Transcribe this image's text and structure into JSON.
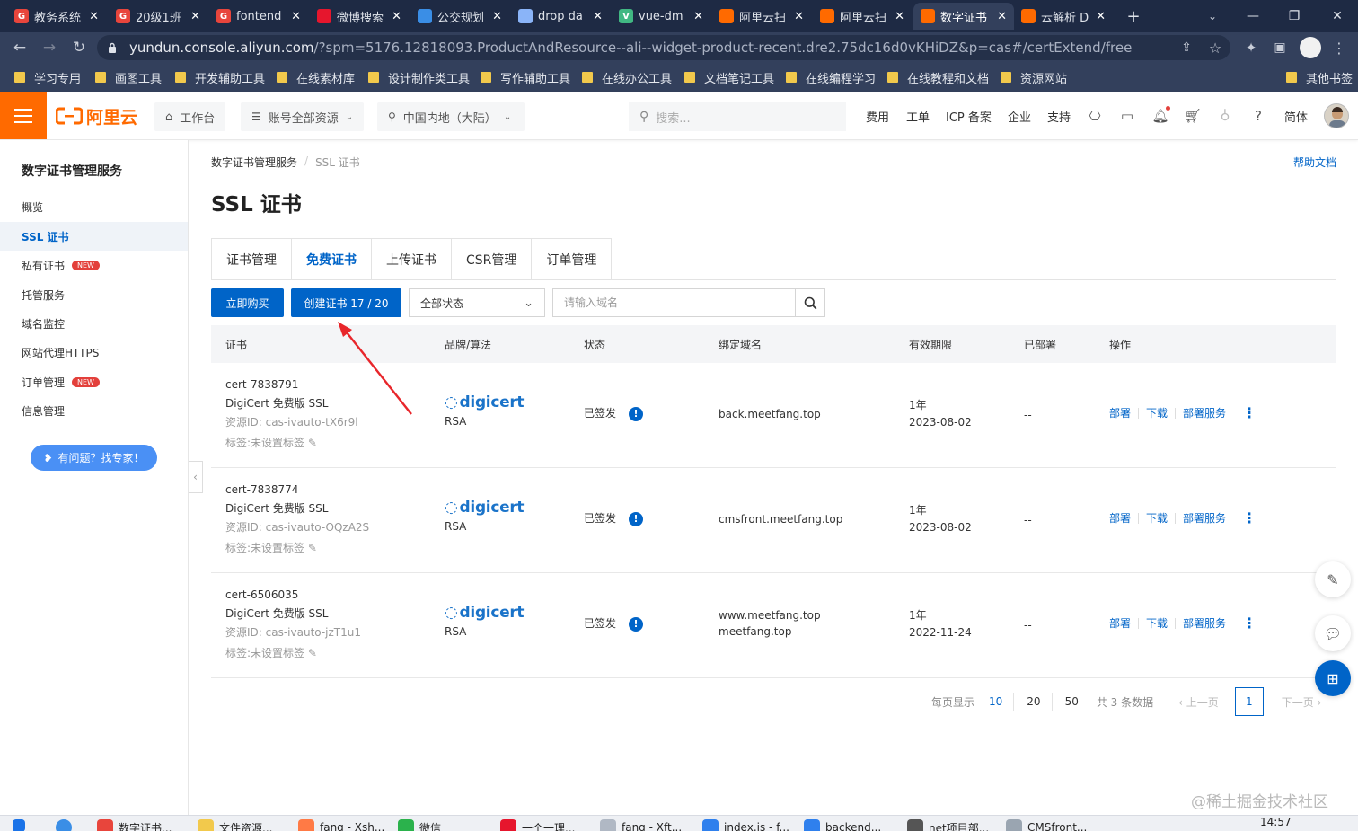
{
  "browser": {
    "tabs": [
      {
        "label": "教务系统",
        "icon": "G",
        "icon_color": "#e8453c"
      },
      {
        "label": "20级1班",
        "icon": "G",
        "icon_color": "#e8453c"
      },
      {
        "label": "fontend",
        "icon": "G",
        "icon_color": "#e8453c"
      },
      {
        "label": "微博搜索",
        "icon": "weibo",
        "icon_color": "#e6162d"
      },
      {
        "label": "公交规划",
        "icon": "map",
        "icon_color": "#3a8ee6"
      },
      {
        "label": "drop da",
        "icon": "search",
        "icon_color": "#8ab4f8"
      },
      {
        "label": "vue-dm",
        "icon": "V",
        "icon_color": "#41b883"
      },
      {
        "label": "阿里云扫",
        "icon": "aliyun",
        "icon_color": "#ff6a00"
      },
      {
        "label": "阿里云扫",
        "icon": "aliyun",
        "icon_color": "#ff6a00"
      },
      {
        "label": "数字证书",
        "icon": "aliyun",
        "icon_color": "#ff6a00"
      },
      {
        "label": "云解析 D",
        "icon": "aliyun",
        "icon_color": "#ff6a00"
      }
    ],
    "url_main": "yundun.console.aliyun.com",
    "url_rest": "/?spm=5176.12818093.ProductAndResource--ali--widget-product-recent.dre2.75dc16d0vKHiDZ&p=cas#/certExtend/free",
    "bookmarks": [
      "学习专用",
      "画图工具",
      "开发辅助工具",
      "在线素材库",
      "设计制作类工具",
      "写作辅助工具",
      "在线办公工具",
      "文档笔记工具",
      "在线编程学习",
      "在线教程和文档",
      "资源网站",
      "其他书签"
    ]
  },
  "topnav": {
    "logo": "阿里云",
    "workbench": "工作台",
    "account_resources": "账号全部资源",
    "region": "中国内地（大陆）",
    "search_placeholder": "搜索...",
    "links": [
      "费用",
      "工单",
      "ICP 备案",
      "企业",
      "支持"
    ],
    "lang": "简体"
  },
  "sidebar": {
    "title": "数字证书管理服务",
    "items": [
      {
        "label": "概览",
        "badge": ""
      },
      {
        "label": "SSL 证书",
        "badge": ""
      },
      {
        "label": "私有证书",
        "badge": "NEW"
      },
      {
        "label": "托管服务",
        "badge": ""
      },
      {
        "label": "域名监控",
        "badge": ""
      },
      {
        "label": "网站代理HTTPS",
        "badge": ""
      },
      {
        "label": "订单管理",
        "badge": "NEW"
      },
      {
        "label": "信息管理",
        "badge": ""
      }
    ],
    "help_button": "有问题？找专家！"
  },
  "main": {
    "breadcrumb": [
      "数字证书管理服务",
      "SSL 证书"
    ],
    "help_doc": "帮助文档",
    "title": "SSL 证书",
    "tabs": [
      "证书管理",
      "免费证书",
      "上传证书",
      "CSR管理",
      "订单管理"
    ],
    "active_tab": "免费证书",
    "buy_button": "立即购买",
    "create_button": "创建证书 17 / 20",
    "status_select": "全部状态",
    "domain_placeholder": "请输入域名",
    "columns": [
      "证书",
      "品牌/算法",
      "状态",
      "绑定域名",
      "有效期限",
      "已部署",
      "操作"
    ],
    "rows": [
      {
        "id": "cert-7838791",
        "product": "DigiCert 免费版 SSL",
        "resource": "资源ID: cas-ivauto-tX6r9l",
        "tags": "标签:未设置标签",
        "brand": "digicert",
        "algo": "RSA",
        "status": "已签发",
        "domain1": "back.meetfang.top",
        "domain2": "",
        "period": "1年",
        "expire": "2023-08-02",
        "deployed": "--"
      },
      {
        "id": "cert-7838774",
        "product": "DigiCert 免费版 SSL",
        "resource": "资源ID: cas-ivauto-OQzA2S",
        "tags": "标签:未设置标签",
        "brand": "digicert",
        "algo": "RSA",
        "status": "已签发",
        "domain1": "cmsfront.meetfang.top",
        "domain2": "",
        "period": "1年",
        "expire": "2023-08-02",
        "deployed": "--"
      },
      {
        "id": "cert-6506035",
        "product": "DigiCert 免费版 SSL",
        "resource": "资源ID: cas-ivauto-jzT1u1",
        "tags": "标签:未设置标签",
        "brand": "digicert",
        "algo": "RSA",
        "status": "已签发",
        "domain1": "www.meetfang.top",
        "domain2": "meetfang.top",
        "period": "1年",
        "expire": "2022-11-24",
        "deployed": "--"
      }
    ],
    "ops": [
      "部署",
      "下载",
      "部署服务"
    ],
    "pager": {
      "per_page_label": "每页显示",
      "sizes": [
        "10",
        "20",
        "50"
      ],
      "total": "共 3 条数据",
      "prev": "上一页",
      "page": "1",
      "next": "下一页"
    }
  },
  "watermark": "@稀土掘金技术社区",
  "taskbar": {
    "items": [
      "数字证书...",
      "文件资源...",
      "fang - Xsh...",
      "微信",
      "一个一理...",
      "fang - Xft...",
      "index.js - f...",
      "backend...",
      "net项目部...",
      "CMSfront..."
    ],
    "time": "14:57"
  },
  "colors": {
    "accent": "#0064c8",
    "brand": "#ff6a00",
    "badge": "#e3403b",
    "annotation_arrow": "#e8262b"
  }
}
